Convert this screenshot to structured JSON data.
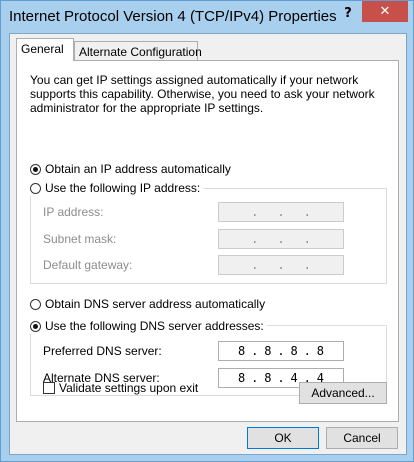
{
  "window": {
    "title": "Internet Protocol Version 4 (TCP/IPv4) Properties",
    "help_label": "?",
    "close_label": "✕"
  },
  "tabs": [
    {
      "label": "General",
      "active": true
    },
    {
      "label": "Alternate Configuration",
      "active": false
    }
  ],
  "general": {
    "description": "You can get IP settings assigned automatically if your network supports this capability. Otherwise, you need to ask your network administrator for the appropriate IP settings.",
    "ip_auto_label": "Obtain an IP address automatically",
    "ip_manual_label": "Use the following IP address:",
    "ip_mode": "auto",
    "ip_fields": [
      {
        "label": "IP address:",
        "octets": [
          "",
          "",
          "",
          ""
        ]
      },
      {
        "label": "Subnet mask:",
        "octets": [
          "",
          "",
          "",
          ""
        ]
      },
      {
        "label": "Default gateway:",
        "octets": [
          "",
          "",
          "",
          ""
        ]
      }
    ],
    "dns_auto_label": "Obtain DNS server address automatically",
    "dns_manual_label": "Use the following DNS server addresses:",
    "dns_mode": "manual",
    "dns_fields": [
      {
        "label": "Preferred DNS server:",
        "octets": [
          "8",
          "8",
          "8",
          "8"
        ]
      },
      {
        "label": "Alternate DNS server:",
        "octets": [
          "8",
          "8",
          "4",
          "4"
        ]
      }
    ],
    "validate_label": "Validate settings upon exit",
    "validate_checked": false,
    "advanced_label": "Advanced..."
  },
  "footer": {
    "ok_label": "OK",
    "cancel_label": "Cancel"
  }
}
